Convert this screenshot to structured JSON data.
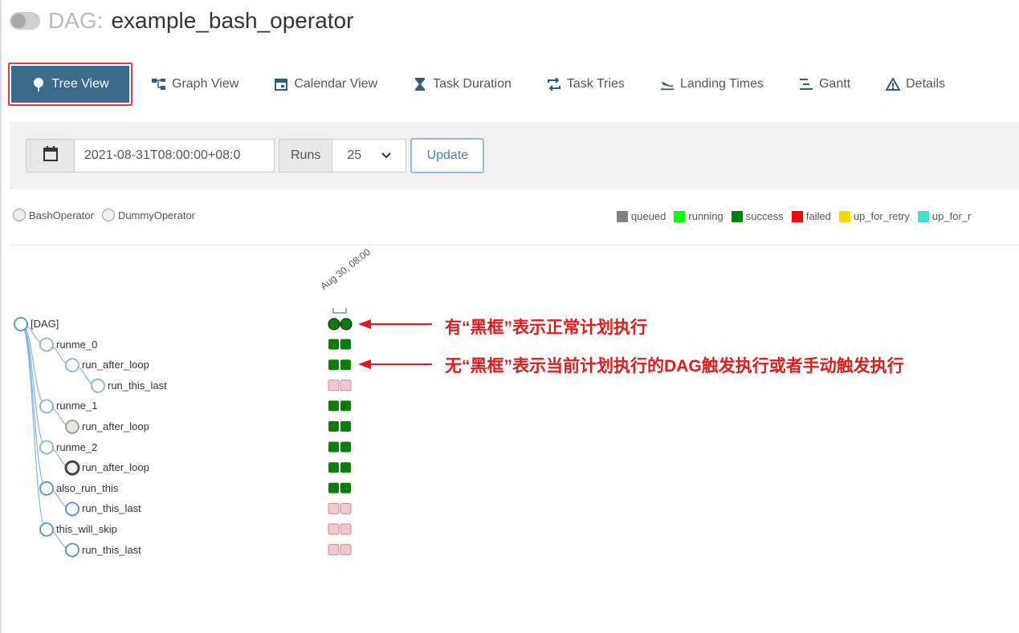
{
  "title": {
    "prefix": "DAG:",
    "name": "example_bash_operator"
  },
  "tabs": [
    {
      "label": "Tree View",
      "icon": "tree-icon",
      "active": true
    },
    {
      "label": "Graph View",
      "icon": "graph-icon",
      "active": false
    },
    {
      "label": "Calendar View",
      "icon": "calendar-icon",
      "active": false
    },
    {
      "label": "Task Duration",
      "icon": "hourglass-icon",
      "active": false
    },
    {
      "label": "Task Tries",
      "icon": "retry-icon",
      "active": false
    },
    {
      "label": "Landing Times",
      "icon": "landing-icon",
      "active": false
    },
    {
      "label": "Gantt",
      "icon": "gantt-icon",
      "active": false
    },
    {
      "label": "Details",
      "icon": "warning-icon",
      "active": false
    }
  ],
  "controls": {
    "date_value": "2021-08-31T08:00:00+08:0",
    "runs_label": "Runs",
    "runs_value": "25",
    "update_label": "Update"
  },
  "operators": [
    {
      "label": "BashOperator",
      "color": "#f0ede4"
    },
    {
      "label": "DummyOperator",
      "color": "#e8f7e4"
    }
  ],
  "states": [
    {
      "label": "queued",
      "color": "#808080"
    },
    {
      "label": "running",
      "color": "#00ff00"
    },
    {
      "label": "success",
      "color": "#008000"
    },
    {
      "label": "failed",
      "color": "#ff0000"
    },
    {
      "label": "up_for_retry",
      "color": "#ffd700"
    },
    {
      "label": "up_for_r",
      "color": "#40e0d0"
    }
  ],
  "run_date": "Aug 30, 08:00",
  "tree": [
    {
      "label": "[DAG]",
      "depth": 0,
      "parent": null,
      "node_fill": "#ffffff",
      "node_stroke": "#4a90d9",
      "status": [
        "success-circle",
        "success-circle"
      ]
    },
    {
      "label": "runme_0",
      "depth": 1,
      "parent": 0,
      "node_fill": "#ffffff",
      "node_stroke": "#7fb3e0",
      "status": [
        "success",
        "success"
      ]
    },
    {
      "label": "run_after_loop",
      "depth": 2,
      "parent": 1,
      "node_fill": "#ffffff",
      "node_stroke": "#7fb3e0",
      "status": [
        "success",
        "success"
      ]
    },
    {
      "label": "run_this_last",
      "depth": 3,
      "parent": 2,
      "node_fill": "#ffffff",
      "node_stroke": "#7fb3e0",
      "status": [
        "none",
        "none"
      ]
    },
    {
      "label": "runme_1",
      "depth": 1,
      "parent": 0,
      "node_fill": "#ffffff",
      "node_stroke": "#7fb3e0",
      "status": [
        "success",
        "success"
      ]
    },
    {
      "label": "run_after_loop",
      "depth": 2,
      "parent": 4,
      "node_fill": "#e8e4da",
      "node_stroke": "#9a9a8a",
      "status": [
        "success",
        "success"
      ]
    },
    {
      "label": "runme_2",
      "depth": 1,
      "parent": 0,
      "node_fill": "#ffffff",
      "node_stroke": "#7fb3e0",
      "status": [
        "success",
        "success"
      ]
    },
    {
      "label": "run_after_loop",
      "depth": 2,
      "parent": 6,
      "node_fill": "#f0f0f0",
      "node_stroke": "#444444",
      "status": [
        "success",
        "success"
      ]
    },
    {
      "label": "also_run_this",
      "depth": 1,
      "parent": 0,
      "node_fill": "#ffffff",
      "node_stroke": "#4a90d9",
      "status": [
        "success",
        "success"
      ]
    },
    {
      "label": "run_this_last",
      "depth": 2,
      "parent": 8,
      "node_fill": "#ffffff",
      "node_stroke": "#4a90d9",
      "status": [
        "none",
        "none"
      ]
    },
    {
      "label": "this_will_skip",
      "depth": 1,
      "parent": 0,
      "node_fill": "#ffffff",
      "node_stroke": "#4a90d9",
      "status": [
        "none",
        "none"
      ]
    },
    {
      "label": "run_this_last",
      "depth": 2,
      "parent": 10,
      "node_fill": "#ffffff",
      "node_stroke": "#4a90d9",
      "status": [
        "none",
        "none"
      ]
    }
  ],
  "status_colors": {
    "success": "#0a7d0a",
    "none": "#f3c6cc",
    "none_border": "#c98a94"
  },
  "annotations": [
    {
      "text": "有“黑框”表示正常计划执行",
      "target_row": 0
    },
    {
      "text": "无“黑框”表示当前计划执行的DAG触发执行或者手动触发执行",
      "target_row": 2
    }
  ],
  "annotation_color": "#e01b1b"
}
